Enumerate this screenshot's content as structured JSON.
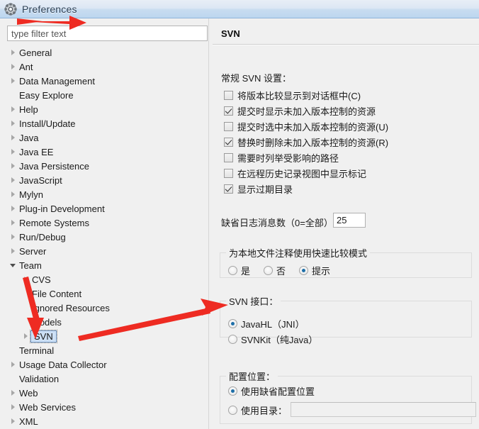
{
  "window": {
    "title": "Preferences",
    "icon": "gear-icon"
  },
  "sidebar": {
    "filter": {
      "placeholder": "type filter text",
      "value": ""
    },
    "items": [
      {
        "label": "General",
        "indent": 0,
        "twisty": "collapsed",
        "selected": false
      },
      {
        "label": "Ant",
        "indent": 0,
        "twisty": "collapsed",
        "selected": false
      },
      {
        "label": "Data Management",
        "indent": 0,
        "twisty": "collapsed",
        "selected": false
      },
      {
        "label": "Easy Explore",
        "indent": 0,
        "twisty": "none",
        "selected": false
      },
      {
        "label": "Help",
        "indent": 0,
        "twisty": "collapsed",
        "selected": false
      },
      {
        "label": "Install/Update",
        "indent": 0,
        "twisty": "collapsed",
        "selected": false
      },
      {
        "label": "Java",
        "indent": 0,
        "twisty": "collapsed",
        "selected": false
      },
      {
        "label": "Java EE",
        "indent": 0,
        "twisty": "collapsed",
        "selected": false
      },
      {
        "label": "Java Persistence",
        "indent": 0,
        "twisty": "collapsed",
        "selected": false
      },
      {
        "label": "JavaScript",
        "indent": 0,
        "twisty": "collapsed",
        "selected": false
      },
      {
        "label": "Mylyn",
        "indent": 0,
        "twisty": "collapsed",
        "selected": false
      },
      {
        "label": "Plug-in Development",
        "indent": 0,
        "twisty": "collapsed",
        "selected": false
      },
      {
        "label": "Remote Systems",
        "indent": 0,
        "twisty": "collapsed",
        "selected": false
      },
      {
        "label": "Run/Debug",
        "indent": 0,
        "twisty": "collapsed",
        "selected": false
      },
      {
        "label": "Server",
        "indent": 0,
        "twisty": "collapsed",
        "selected": false
      },
      {
        "label": "Team",
        "indent": 0,
        "twisty": "expanded",
        "selected": false
      },
      {
        "label": "CVS",
        "indent": 1,
        "twisty": "collapsed",
        "selected": false
      },
      {
        "label": "File Content",
        "indent": 1,
        "twisty": "none",
        "selected": false
      },
      {
        "label": "Ignored Resources",
        "indent": 1,
        "twisty": "none",
        "selected": false
      },
      {
        "label": "Models",
        "indent": 1,
        "twisty": "none",
        "selected": false
      },
      {
        "label": "SVN",
        "indent": 1,
        "twisty": "collapsed",
        "selected": true
      },
      {
        "label": "Terminal",
        "indent": 0,
        "twisty": "none",
        "selected": false
      },
      {
        "label": "Usage Data Collector",
        "indent": 0,
        "twisty": "collapsed",
        "selected": false
      },
      {
        "label": "Validation",
        "indent": 0,
        "twisty": "none",
        "selected": false
      },
      {
        "label": "Web",
        "indent": 0,
        "twisty": "collapsed",
        "selected": false
      },
      {
        "label": "Web Services",
        "indent": 0,
        "twisty": "collapsed",
        "selected": false
      },
      {
        "label": "XML",
        "indent": 0,
        "twisty": "collapsed",
        "selected": false
      }
    ]
  },
  "page": {
    "title": "SVN",
    "general_section_label": "常规 SVN 设置：",
    "checkboxes": [
      {
        "label": "将版本比较显示到对话框中(C)",
        "checked": false
      },
      {
        "label": "提交时显示未加入版本控制的资源",
        "checked": true
      },
      {
        "label": "提交时选中未加入版本控制的资源(U)",
        "checked": false
      },
      {
        "label": "替换时删除未加入版本控制的资源(R)",
        "checked": true
      },
      {
        "label": "需要时列举受影响的路径",
        "checked": false
      },
      {
        "label": "在远程历史记录视图中显示标记",
        "checked": false
      },
      {
        "label": "显示过期目录",
        "checked": true
      }
    ],
    "log_messages": {
      "label": "缺省日志消息数（0=全部）",
      "value": "25"
    },
    "quick_compare_group": {
      "legend": "为本地文件注释使用快速比较模式",
      "options": [
        {
          "label": "是",
          "selected": false
        },
        {
          "label": "否",
          "selected": false
        },
        {
          "label": "提示",
          "selected": true
        }
      ]
    },
    "svn_interface_group": {
      "legend": "SVN 接口：",
      "options": [
        {
          "label": "JavaHL（JNI）",
          "selected": true
        },
        {
          "label": "SVNKit（纯Java）",
          "selected": false
        }
      ]
    },
    "config_location_group": {
      "legend": "配置位置：",
      "options": [
        {
          "label": "使用缺省配置位置",
          "selected": true
        },
        {
          "label": "使用目录：",
          "selected": false
        }
      ],
      "directory_value": ""
    }
  },
  "annotations": {
    "accent_color": "#ee2b22",
    "arrows": [
      {
        "name": "arrow-to-title",
        "desc": "short arrow pointing right toward window title"
      },
      {
        "name": "arrow-to-svn-tree",
        "desc": "arrow pointing down-right to SVN tree item"
      },
      {
        "name": "arrow-to-javahl",
        "desc": "long arrow pointing up-right to JavaHL radio"
      }
    ]
  }
}
